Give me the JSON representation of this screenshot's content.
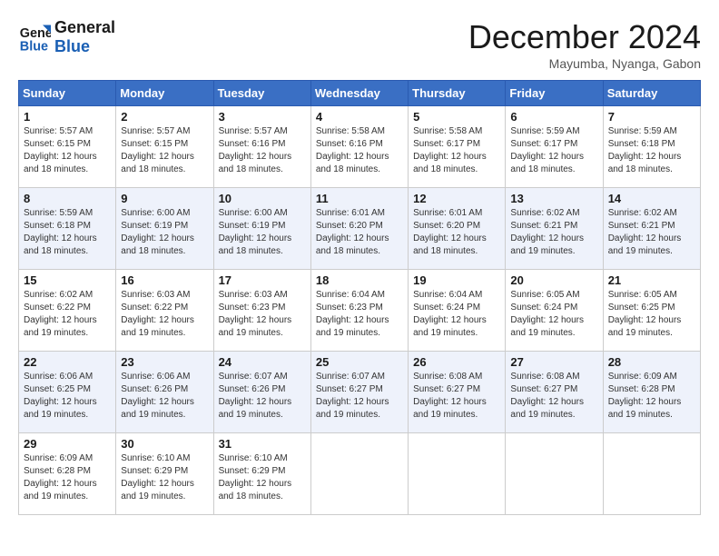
{
  "header": {
    "logo_line1": "General",
    "logo_line2": "Blue",
    "month_title": "December 2024",
    "location": "Mayumba, Nyanga, Gabon"
  },
  "weekdays": [
    "Sunday",
    "Monday",
    "Tuesday",
    "Wednesday",
    "Thursday",
    "Friday",
    "Saturday"
  ],
  "weeks": [
    [
      {
        "day": "1",
        "sunrise": "5:57 AM",
        "sunset": "6:15 PM",
        "daylight": "12 hours and 18 minutes."
      },
      {
        "day": "2",
        "sunrise": "5:57 AM",
        "sunset": "6:15 PM",
        "daylight": "12 hours and 18 minutes."
      },
      {
        "day": "3",
        "sunrise": "5:57 AM",
        "sunset": "6:16 PM",
        "daylight": "12 hours and 18 minutes."
      },
      {
        "day": "4",
        "sunrise": "5:58 AM",
        "sunset": "6:16 PM",
        "daylight": "12 hours and 18 minutes."
      },
      {
        "day": "5",
        "sunrise": "5:58 AM",
        "sunset": "6:17 PM",
        "daylight": "12 hours and 18 minutes."
      },
      {
        "day": "6",
        "sunrise": "5:59 AM",
        "sunset": "6:17 PM",
        "daylight": "12 hours and 18 minutes."
      },
      {
        "day": "7",
        "sunrise": "5:59 AM",
        "sunset": "6:18 PM",
        "daylight": "12 hours and 18 minutes."
      }
    ],
    [
      {
        "day": "8",
        "sunrise": "5:59 AM",
        "sunset": "6:18 PM",
        "daylight": "12 hours and 18 minutes."
      },
      {
        "day": "9",
        "sunrise": "6:00 AM",
        "sunset": "6:19 PM",
        "daylight": "12 hours and 18 minutes."
      },
      {
        "day": "10",
        "sunrise": "6:00 AM",
        "sunset": "6:19 PM",
        "daylight": "12 hours and 18 minutes."
      },
      {
        "day": "11",
        "sunrise": "6:01 AM",
        "sunset": "6:20 PM",
        "daylight": "12 hours and 18 minutes."
      },
      {
        "day": "12",
        "sunrise": "6:01 AM",
        "sunset": "6:20 PM",
        "daylight": "12 hours and 18 minutes."
      },
      {
        "day": "13",
        "sunrise": "6:02 AM",
        "sunset": "6:21 PM",
        "daylight": "12 hours and 19 minutes."
      },
      {
        "day": "14",
        "sunrise": "6:02 AM",
        "sunset": "6:21 PM",
        "daylight": "12 hours and 19 minutes."
      }
    ],
    [
      {
        "day": "15",
        "sunrise": "6:02 AM",
        "sunset": "6:22 PM",
        "daylight": "12 hours and 19 minutes."
      },
      {
        "day": "16",
        "sunrise": "6:03 AM",
        "sunset": "6:22 PM",
        "daylight": "12 hours and 19 minutes."
      },
      {
        "day": "17",
        "sunrise": "6:03 AM",
        "sunset": "6:23 PM",
        "daylight": "12 hours and 19 minutes."
      },
      {
        "day": "18",
        "sunrise": "6:04 AM",
        "sunset": "6:23 PM",
        "daylight": "12 hours and 19 minutes."
      },
      {
        "day": "19",
        "sunrise": "6:04 AM",
        "sunset": "6:24 PM",
        "daylight": "12 hours and 19 minutes."
      },
      {
        "day": "20",
        "sunrise": "6:05 AM",
        "sunset": "6:24 PM",
        "daylight": "12 hours and 19 minutes."
      },
      {
        "day": "21",
        "sunrise": "6:05 AM",
        "sunset": "6:25 PM",
        "daylight": "12 hours and 19 minutes."
      }
    ],
    [
      {
        "day": "22",
        "sunrise": "6:06 AM",
        "sunset": "6:25 PM",
        "daylight": "12 hours and 19 minutes."
      },
      {
        "day": "23",
        "sunrise": "6:06 AM",
        "sunset": "6:26 PM",
        "daylight": "12 hours and 19 minutes."
      },
      {
        "day": "24",
        "sunrise": "6:07 AM",
        "sunset": "6:26 PM",
        "daylight": "12 hours and 19 minutes."
      },
      {
        "day": "25",
        "sunrise": "6:07 AM",
        "sunset": "6:27 PM",
        "daylight": "12 hours and 19 minutes."
      },
      {
        "day": "26",
        "sunrise": "6:08 AM",
        "sunset": "6:27 PM",
        "daylight": "12 hours and 19 minutes."
      },
      {
        "day": "27",
        "sunrise": "6:08 AM",
        "sunset": "6:27 PM",
        "daylight": "12 hours and 19 minutes."
      },
      {
        "day": "28",
        "sunrise": "6:09 AM",
        "sunset": "6:28 PM",
        "daylight": "12 hours and 19 minutes."
      }
    ],
    [
      {
        "day": "29",
        "sunrise": "6:09 AM",
        "sunset": "6:28 PM",
        "daylight": "12 hours and 19 minutes."
      },
      {
        "day": "30",
        "sunrise": "6:10 AM",
        "sunset": "6:29 PM",
        "daylight": "12 hours and 19 minutes."
      },
      {
        "day": "31",
        "sunrise": "6:10 AM",
        "sunset": "6:29 PM",
        "daylight": "12 hours and 18 minutes."
      },
      null,
      null,
      null,
      null
    ]
  ]
}
